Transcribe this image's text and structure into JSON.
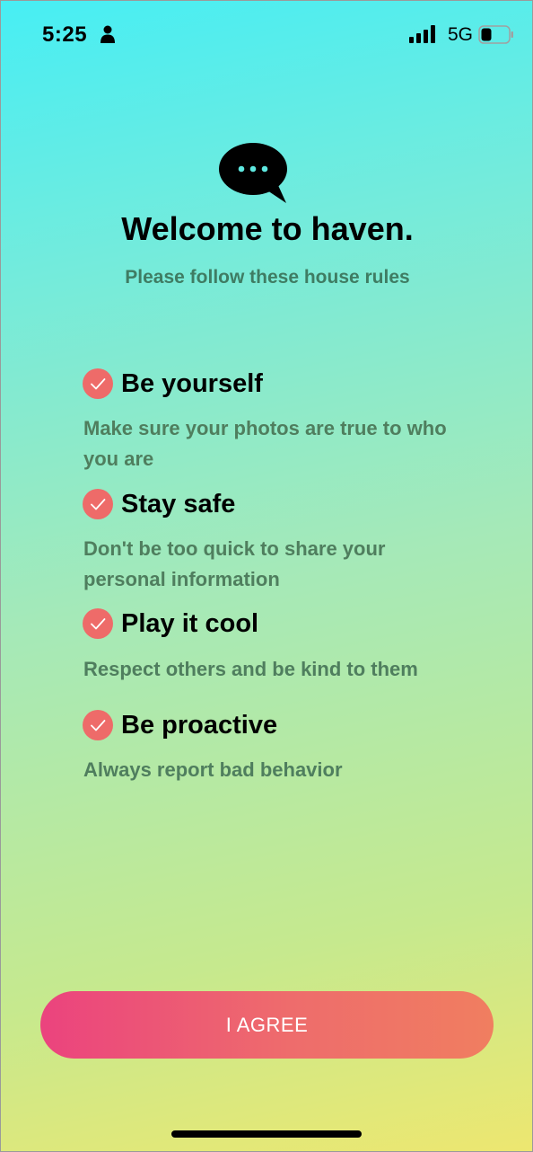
{
  "status_bar": {
    "time": "5:25",
    "network": "5G",
    "icons": [
      "person-icon",
      "signal-icon",
      "battery-icon"
    ]
  },
  "header": {
    "icon": "chat-bubble-icon",
    "title": "Welcome to haven.",
    "subtitle": "Please follow these house rules"
  },
  "rules": [
    {
      "title": "Be yourself",
      "description": "Make sure your photos are true to who you are"
    },
    {
      "title": "Stay safe",
      "description": "Don't be too quick to share your personal information"
    },
    {
      "title": "Play it cool",
      "description": "Respect others and be kind to them"
    },
    {
      "title": "Be proactive",
      "description": "Always report bad behavior"
    }
  ],
  "agree_button": {
    "label": "I AGREE"
  },
  "colors": {
    "check": "#ee6b69",
    "subtitle_text": "#3f7c63",
    "description_text": "#4f7e5e",
    "button_start": "#eb437e",
    "button_end": "#f07e60",
    "background_top": "#47eef4",
    "background_bottom": "#ede770"
  }
}
